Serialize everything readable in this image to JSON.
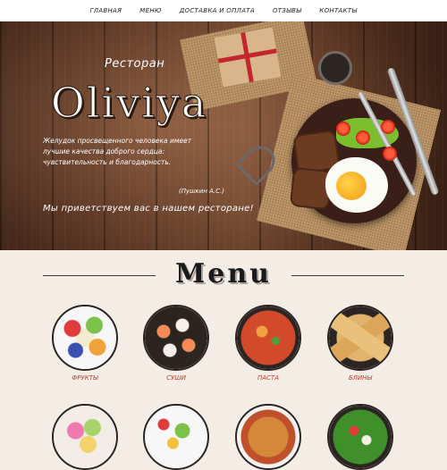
{
  "nav": {
    "items": [
      {
        "label": "Главная"
      },
      {
        "label": "Меню"
      },
      {
        "label": "Доставка и оплата"
      },
      {
        "label": "Отзывы"
      },
      {
        "label": "Контакты"
      }
    ]
  },
  "hero": {
    "subtitle": "Ресторан",
    "brand": "Oliviya",
    "quote_lines": [
      "Желудок просвещенного человека имеет",
      "лучшие качества доброго сердца:",
      "чувствительность и благодарность."
    ],
    "author": "(Пушкин А.С.)",
    "welcome": "Мы приветствуем вас в нашем ресторане!"
  },
  "menu": {
    "title": "Menu",
    "categories": [
      {
        "label": "Фрукты",
        "icon": "fruits-dish-icon",
        "color": "#f2f2f2"
      },
      {
        "label": "Суши",
        "icon": "sushi-dish-icon",
        "color": "#2b2522"
      },
      {
        "label": "Паста",
        "icon": "pasta-dish-icon",
        "color": "#d24a2a"
      },
      {
        "label": "Блины",
        "icon": "crepes-dish-icon",
        "color": "#e2b36c"
      }
    ],
    "second_row": [
      {
        "icon": "ice-cream-dish-icon"
      },
      {
        "icon": "salad-dish-icon"
      },
      {
        "icon": "soup-dish-icon"
      },
      {
        "icon": "greens-salad-dish-icon"
      }
    ]
  },
  "colors": {
    "accent": "#c23a2f",
    "page_bg": "#f3ede5"
  }
}
